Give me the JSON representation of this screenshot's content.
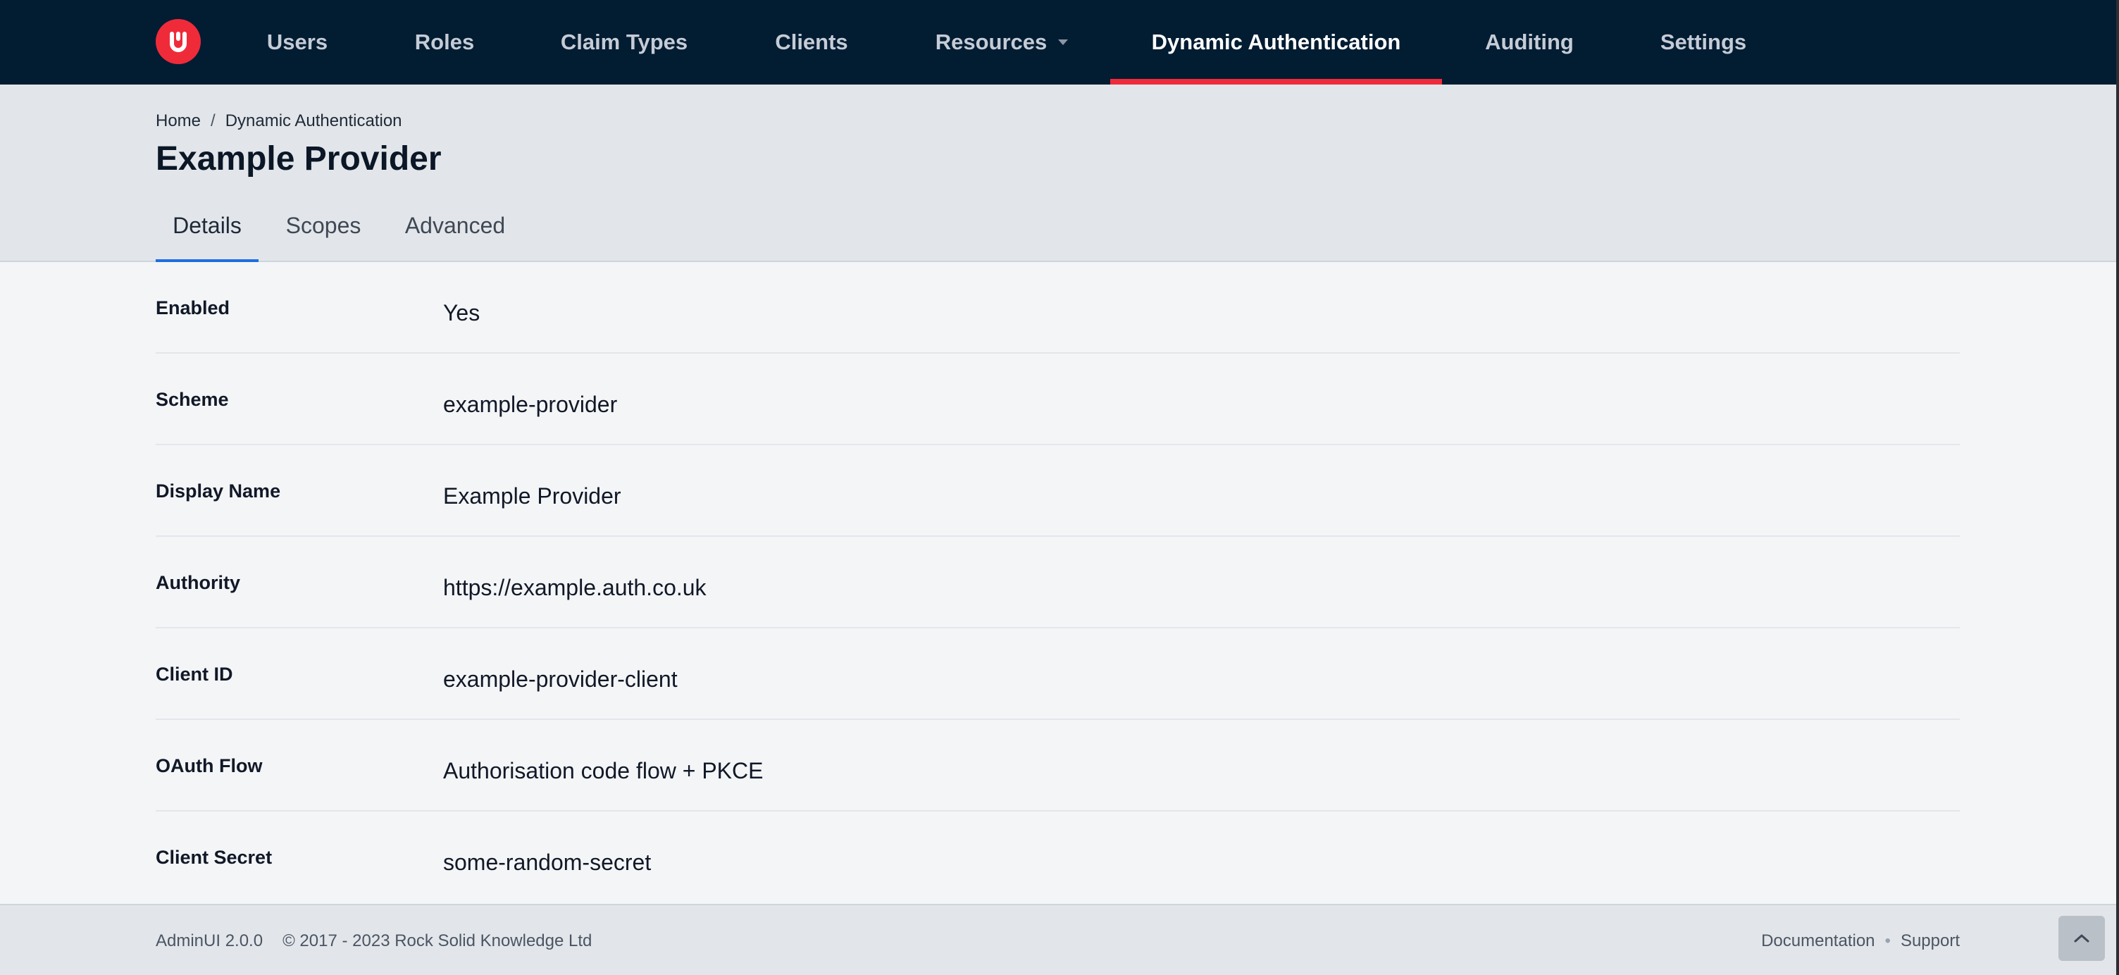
{
  "nav": {
    "logo_letter": "U",
    "items": [
      {
        "label": "Users"
      },
      {
        "label": "Roles"
      },
      {
        "label": "Claim Types"
      },
      {
        "label": "Clients"
      },
      {
        "label": "Resources"
      },
      {
        "label": "Dynamic Authentication"
      },
      {
        "label": "Auditing"
      },
      {
        "label": "Settings"
      }
    ],
    "active_item": "Dynamic Authentication",
    "accent_color": "#ef2b3a",
    "background_color": "#021c32"
  },
  "breadcrumb": {
    "items": [
      "Home",
      "Dynamic Authentication"
    ],
    "separator": "/"
  },
  "page": {
    "title": "Example Provider"
  },
  "tabs": [
    {
      "label": "Details"
    },
    {
      "label": "Scopes"
    },
    {
      "label": "Advanced"
    }
  ],
  "active_tab": "Details",
  "tab_accent_color": "#1d6fe0",
  "details": [
    {
      "label": "Enabled",
      "value": "Yes"
    },
    {
      "label": "Scheme",
      "value": "example-provider"
    },
    {
      "label": "Display Name",
      "value": "Example Provider"
    },
    {
      "label": "Authority",
      "value": "https://example.auth.co.uk"
    },
    {
      "label": "Client ID",
      "value": "example-provider-client"
    },
    {
      "label": "OAuth Flow",
      "value": "Authorisation code flow + PKCE"
    },
    {
      "label": "Client Secret",
      "value": "some-random-secret"
    }
  ],
  "footer": {
    "version": "AdminUI 2.0.0",
    "copyright": "© 2017 - 2023 Rock Solid Knowledge Ltd",
    "links": [
      "Documentation",
      "Support"
    ],
    "link_separator": "•"
  },
  "icons": {
    "logo": "adminui-logo-icon",
    "resources_dropdown": "caret-down-icon",
    "scroll_top": "chevron-up-icon"
  }
}
